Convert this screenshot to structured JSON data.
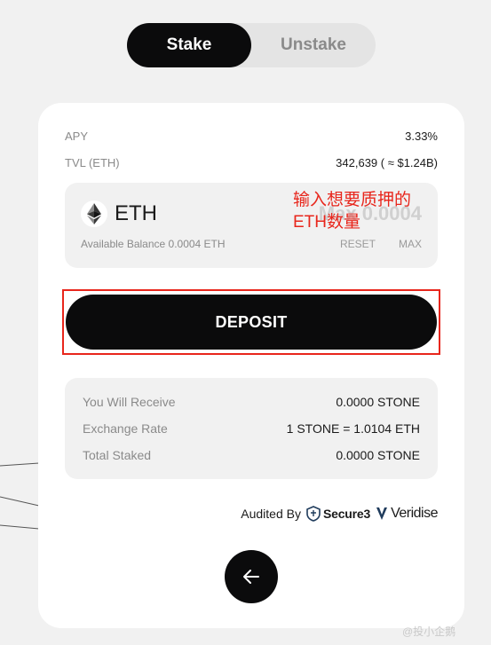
{
  "tabs": {
    "stake": "Stake",
    "unstake": "Unstake",
    "active": "stake"
  },
  "stats": {
    "apy_label": "APY",
    "apy_value": "3.33%",
    "tvl_label": "TVL (ETH)",
    "tvl_value": "342,639 ( ≈ $1.24B)"
  },
  "input": {
    "token": "ETH",
    "token_icon": "ethereum-icon",
    "placeholder": "Max 0.0004",
    "available": "Available Balance 0.0004 ETH",
    "reset_label": "RESET",
    "max_label": "MAX"
  },
  "annotation": "输入想要质押的ETH数量",
  "deposit_label": "DEPOSIT",
  "summary": {
    "rows": [
      {
        "label": "You Will Receive",
        "value": "0.0000 STONE"
      },
      {
        "label": "Exchange Rate",
        "value": "1 STONE = 1.0104 ETH"
      },
      {
        "label": "Total Staked",
        "value": "0.0000 STONE"
      }
    ]
  },
  "audit": {
    "label": "Audited By",
    "auditors": [
      {
        "name": "Secure3",
        "icon": "secure3-icon"
      },
      {
        "name": "Veridise",
        "icon": "veridise-icon"
      }
    ]
  },
  "back_icon": "arrow-left-icon",
  "watermark": "@投小企鹅",
  "colors": {
    "accent": "#0b0b0c",
    "annotation": "#e8261c",
    "panel": "#f1f1f1"
  }
}
